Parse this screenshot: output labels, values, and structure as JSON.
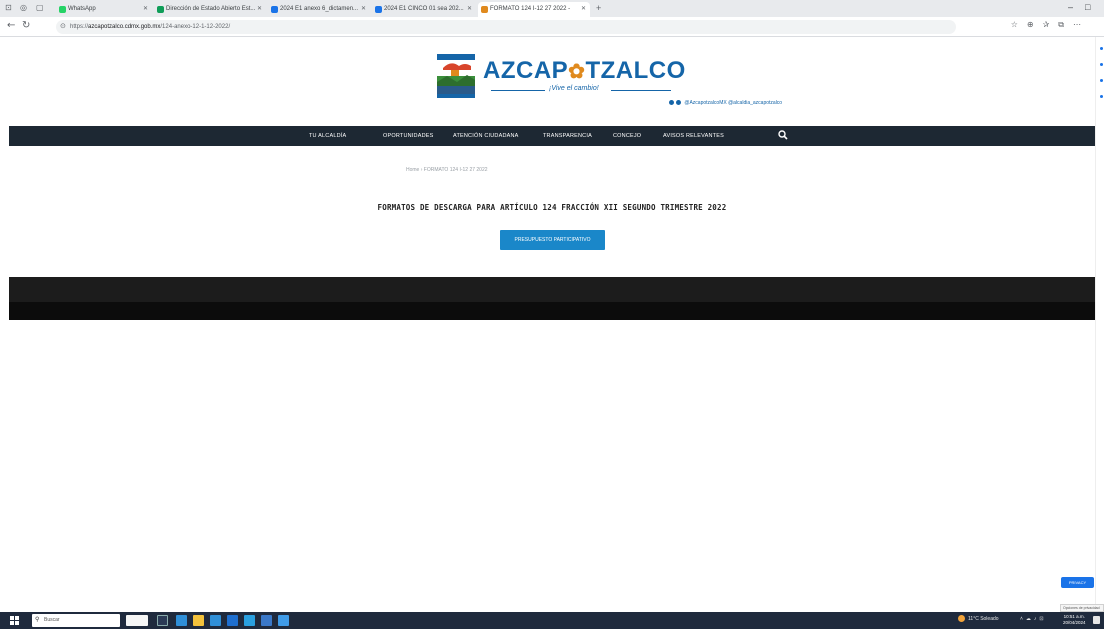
{
  "browser": {
    "tabs": [
      {
        "label": "WhatsApp",
        "color": "#25d366",
        "active": false
      },
      {
        "label": "Dirección de Estado Abierto Est...",
        "color": "#0f9d58",
        "active": false
      },
      {
        "label": "2024 E1 anexo 6_dictamen...",
        "color": "#1a73e8",
        "active": false
      },
      {
        "label": "2024 E1 CINCO 01 sea 202...",
        "color": "#1a73e8",
        "active": false
      },
      {
        "label": "FORMATO 124 I-12 27 2022 -",
        "color": "#e08a1e",
        "active": true
      }
    ],
    "new_tab": "+",
    "window_controls": [
      "–",
      "□"
    ],
    "url_prefix": "https://",
    "url_host": "azcapotzalco.cdmx.gob.mx",
    "url_path": "/124-anexo-12-1-12-2022/"
  },
  "site": {
    "brand": {
      "title_left": "AZCAP",
      "title_right": "TZALCO",
      "tagline": "¡Vive el cambio!",
      "social_handles": "@AzcapotzalcoMX  @alcaldia_azcapotzalco"
    },
    "nav": {
      "items": [
        "TU ALCALDÍA",
        "OPORTUNIDADES",
        "ATENCIÓN CIUDADANA",
        "TRANSPARENCIA",
        "CONCEJO",
        "AVISOS RELEVANTES"
      ],
      "search_icon": "search-icon"
    },
    "breadcrumb": "Home  ›  FORMATO 124 I-12 27 2022",
    "page_title": "FORMATOS DE DESCARGA PARA ARTÍCULO 124 FRACCIÓN XII SEGUNDO TRIMESTRE 2022",
    "cta_button": "PRESUPUESTO PARTICIPATIVO",
    "privacy_button": "PRIVACY",
    "privacy_note": "Opciones de privacidad"
  },
  "taskbar": {
    "search_placeholder": "Buscar",
    "weather": "11°C  Soleado",
    "time": "10:51 a.m.",
    "date": "20/04/2024"
  },
  "colors": {
    "brand_blue": "#1565a8",
    "nav_bg": "#1d2833",
    "cta_blue": "#1a87c9",
    "footer_dark": "#1c1c1c"
  }
}
